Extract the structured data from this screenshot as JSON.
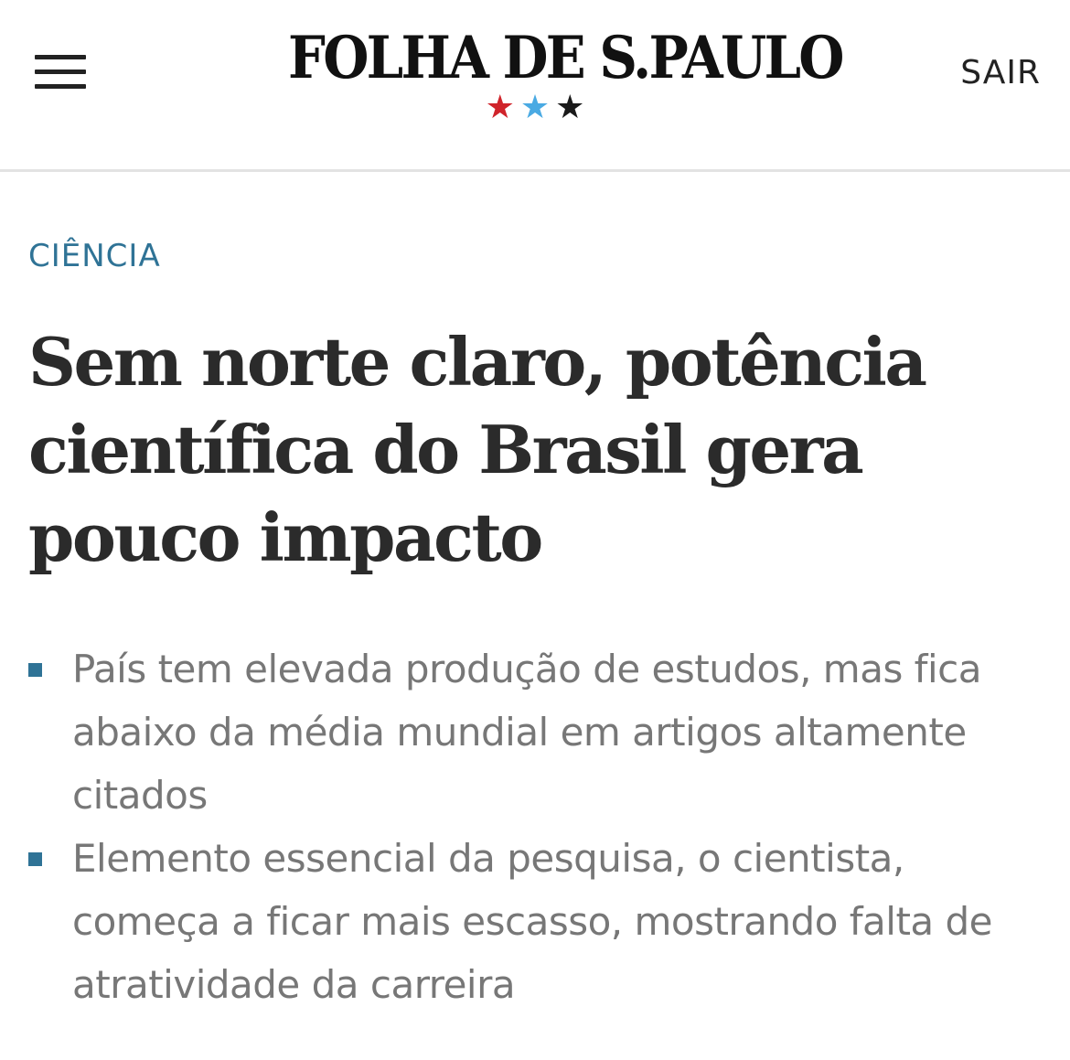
{
  "header": {
    "logo_text": "FOLHA DE S.PAULO",
    "stars": [
      {
        "glyph": "★",
        "color": "#d0242b"
      },
      {
        "glyph": "★",
        "color": "#4aaae3"
      },
      {
        "glyph": "★",
        "color": "#1a1a1a"
      }
    ],
    "sair_label": "SAIR",
    "menu_icon": "hamburger-menu-icon"
  },
  "article": {
    "section": "CIÊNCIA",
    "headline": "Sem norte claro, potência científica do Brasil gera pouco impacto",
    "summary": [
      "País tem elevada produção de estudos, mas fica abaixo da média mundial em artigos altamente citados",
      "Elemento essencial da pesquisa, o cientista, começa a ficar mais escasso, mostrando falta de atratividade da carreira"
    ]
  },
  "colors": {
    "accent": "#2f7396",
    "headline": "#2b2b2b",
    "summary": "#777777",
    "divider": "#e3e3e3"
  }
}
